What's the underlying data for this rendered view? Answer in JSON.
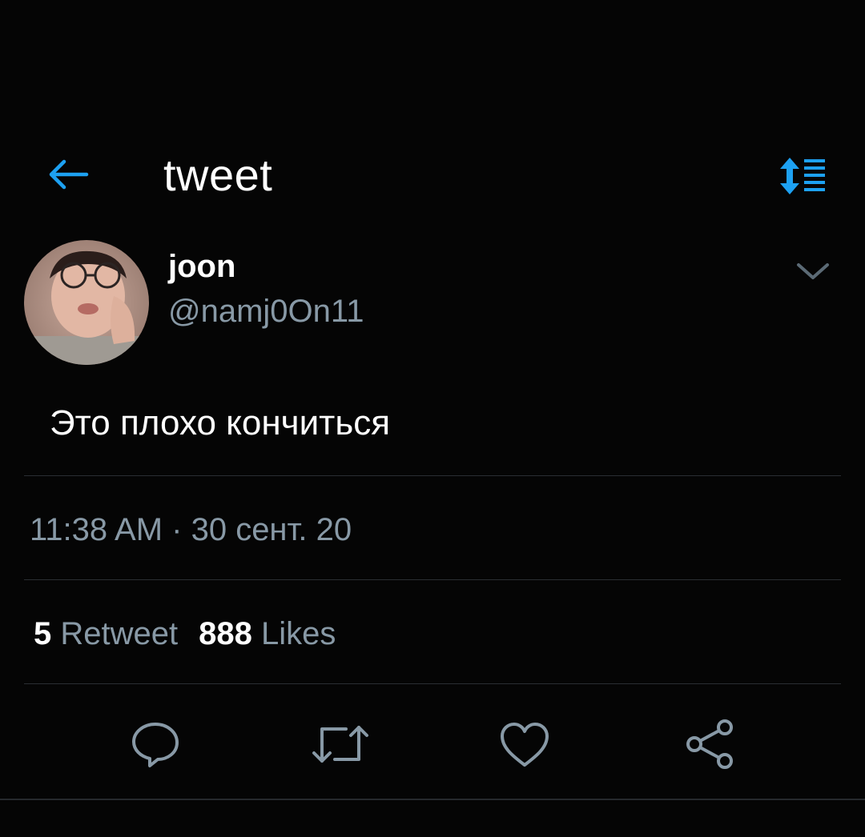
{
  "header": {
    "title": "tweet",
    "back_icon": "arrow-left-icon",
    "sort_icon": "sort-list-icon",
    "accent_color": "#1da1f2"
  },
  "author": {
    "display_name": "joon",
    "handle": "@namj0On11",
    "avatar_icon": "profile-photo",
    "more_icon": "chevron-down-icon"
  },
  "tweet": {
    "text": "Это плохо кончиться",
    "timestamp": "11:38 AM · 30 сент. 20"
  },
  "stats": {
    "retweets_count": "5",
    "retweets_label": "Retweet",
    "likes_count": "888",
    "likes_label": "Likes"
  },
  "actions": {
    "reply_icon": "reply-icon",
    "retweet_icon": "retweet-icon",
    "like_icon": "heart-icon",
    "share_icon": "share-icon",
    "icon_color": "#8899a6"
  },
  "colors": {
    "background": "#050505",
    "secondary_text": "#8899a6",
    "divider": "#2a2e33"
  }
}
